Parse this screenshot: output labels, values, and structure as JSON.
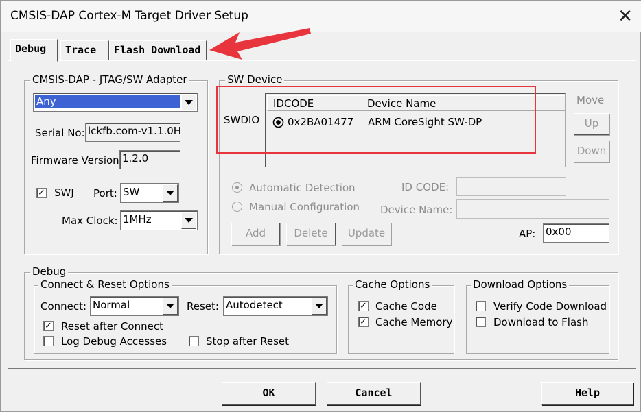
{
  "window": {
    "title": "CMSIS-DAP Cortex-M Target Driver Setup",
    "close": "✕"
  },
  "tabs": [
    "Debug",
    "Trace",
    "Flash Download"
  ],
  "adapter": {
    "group": "CMSIS-DAP - JTAG/SW Adapter",
    "device_selected": "Any",
    "serial_label": "Serial No:",
    "serial_value": "lckfb.com-v1.1.0H",
    "firmware_label": "Firmware Version:",
    "firmware_value": "1.2.0",
    "swj_label": "SWJ",
    "swj_checked": "✓",
    "port_label": "Port:",
    "port_value": "SW",
    "maxclock_label": "Max Clock:",
    "maxclock_value": "1MHz"
  },
  "sw_device": {
    "group": "SW Device",
    "swdio_label": "SWDIO",
    "col_idcode": "IDCODE",
    "col_devname": "Device Name",
    "row_idcode": "0x2BA01477",
    "row_devname": "ARM CoreSight SW-DP",
    "move_label": "Move",
    "up_label": "Up",
    "down_label": "Down",
    "auto_detect": "Automatic Detection",
    "manual_config": "Manual Configuration",
    "idcode_label": "ID CODE:",
    "devname_label": "Device Name:",
    "add_label": "Add",
    "delete_label": "Delete",
    "update_label": "Update",
    "ap_label": "AP:",
    "ap_value": "0x00"
  },
  "debug": {
    "group": "Debug",
    "connect_reset_group": "Connect & Reset Options",
    "connect_label": "Connect:",
    "connect_value": "Normal",
    "reset_label": "Reset:",
    "reset_value": "Autodetect",
    "reset_after_connect": "Reset after Connect",
    "reset_after_connect_checked": "✓",
    "log_debug": "Log Debug Accesses",
    "stop_after_reset": "Stop after Reset",
    "cache_group": "Cache Options",
    "cache_code": "Cache Code",
    "cache_code_checked": "✓",
    "cache_memory": "Cache Memory",
    "cache_memory_checked": "✓",
    "download_group": "Download Options",
    "verify_code": "Verify Code Download",
    "download_flash": "Download to Flash"
  },
  "buttons": {
    "ok": "OK",
    "cancel": "Cancel",
    "help": "Help"
  },
  "colors": {
    "annotation": "#e8343c",
    "selection": "#3c62d3"
  }
}
